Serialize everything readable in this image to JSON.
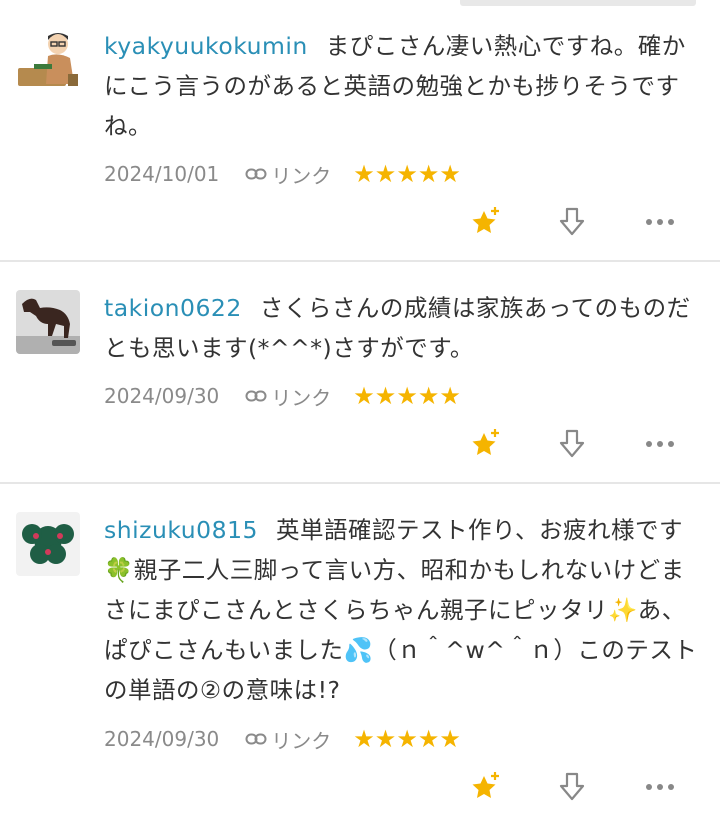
{
  "comments": [
    {
      "username": "kyakyuukokumin",
      "text": "まぴこさん凄い熱心ですね。確かにこう言うのがあると英語の勉強とかも捗りそうですね。",
      "date": "2024/10/01",
      "link_label": "リンク",
      "stars": "★★★★★"
    },
    {
      "username": "takion0622",
      "text": "さくらさんの成績は家族あってのものだとも思います(*^^*)さすがです。",
      "date": "2024/09/30",
      "link_label": "リンク",
      "stars": "★★★★★"
    },
    {
      "username": "shizuku0815",
      "text": "英単語確認テスト作り、お疲れ様です🍀親子二人三脚って言い方、昭和かもしれないけどまさにまぴこさんとさくらちゃん親子にピッタリ✨あ、ぱぴこさんもいました💦（ｎ＾^w^＾ｎ）このテストの単語の②の意味は!?",
      "date": "2024/09/30",
      "link_label": "リンク",
      "stars": "★★★★★"
    }
  ],
  "icons": {
    "avatar_1": "person-at-desk-illustration",
    "avatar_2": "horse-statue-photo",
    "avatar_3": "green-knit-brooch-photo",
    "link": "link-icon",
    "star_action": "star-plus-icon",
    "down_action": "thumbs-down-arrow-icon",
    "more_action": "more-dots-icon"
  },
  "colors": {
    "username": "#2a8fb6",
    "star": "#f5b400",
    "meta": "#8a8a8a",
    "divider": "#e6e6e6"
  }
}
